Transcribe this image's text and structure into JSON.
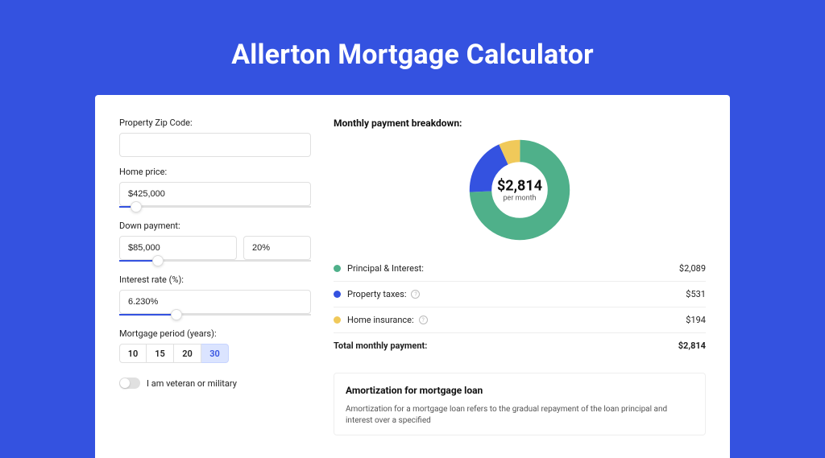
{
  "title": "Allerton Mortgage Calculator",
  "form": {
    "zip_label": "Property Zip Code:",
    "zip_value": "",
    "home_price_label": "Home price:",
    "home_price_value": "$425,000",
    "home_price_slider_pct": 9,
    "down_payment_label": "Down payment:",
    "down_payment_value": "$85,000",
    "down_payment_pct_value": "20%",
    "down_payment_slider_pct": 20,
    "interest_label": "Interest rate (%):",
    "interest_value": "6.230%",
    "interest_slider_pct": 30,
    "period_label": "Mortgage period (years):",
    "period_options": [
      "10",
      "15",
      "20",
      "30"
    ],
    "period_selected_index": 3,
    "veteran_label": "I am veteran or military"
  },
  "breakdown": {
    "heading": "Monthly payment breakdown:",
    "center_amount": "$2,814",
    "center_sub": "per month",
    "items": [
      {
        "label": "Principal & Interest:",
        "value": "$2,089",
        "color": "#4fb08a"
      },
      {
        "label": "Property taxes:",
        "value": "$531",
        "color": "#3452e0",
        "info": true
      },
      {
        "label": "Home insurance:",
        "value": "$194",
        "color": "#f0c95a",
        "info": true
      }
    ],
    "total_label": "Total monthly payment:",
    "total_value": "$2,814"
  },
  "chart_data": {
    "type": "pie",
    "title": "Monthly payment breakdown",
    "series": [
      {
        "name": "Principal & Interest",
        "value": 2089,
        "color": "#4fb08a"
      },
      {
        "name": "Property taxes",
        "value": 531,
        "color": "#3452e0"
      },
      {
        "name": "Home insurance",
        "value": 194,
        "color": "#f0c95a"
      }
    ],
    "total": 2814,
    "center_label": "$2,814 per month"
  },
  "amortization": {
    "title": "Amortization for mortgage loan",
    "text": "Amortization for a mortgage loan refers to the gradual repayment of the loan principal and interest over a specified"
  }
}
